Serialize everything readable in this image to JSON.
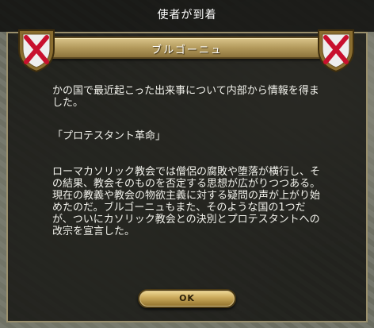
{
  "dialog": {
    "title": "使者が到着",
    "subtitle": "ブルゴーニュ",
    "paragraph1": "かの国で最近起こった出来事について内部から情報を得ました。",
    "paragraph2": "「プロテスタント革命」",
    "paragraph3": "ローマカソリック教会では僧侶の腐敗や堕落が横行し、その結果、教会そのものを否定する思想が広がりつつある。現在の教義や教会の物欲主義に対する疑問の声が上がり始めたのだ。ブルゴーニュもまた、そのような国の1つだが、ついにカソリック教会との決別とプロテスタントへの改宗を宣言した。",
    "ok_label": "OK"
  },
  "colors": {
    "banner_gold": "#c9a859",
    "shield_white": "#eeeeee",
    "cross_red": "#c8102e"
  },
  "icons": {
    "left_shield": "red-saltire-shield-icon",
    "right_shield": "red-saltire-shield-icon"
  }
}
